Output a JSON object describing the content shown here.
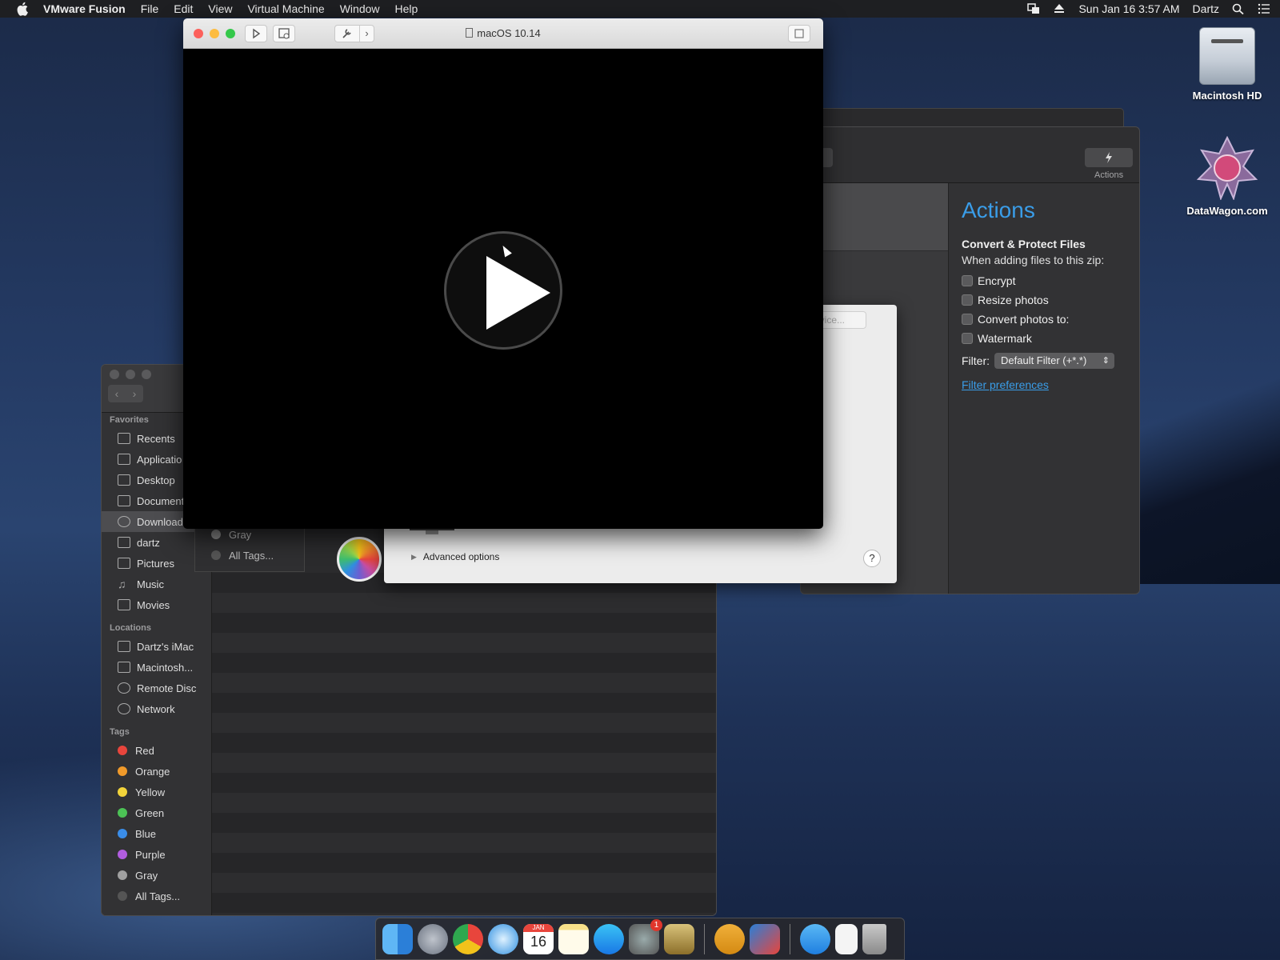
{
  "menubar": {
    "app_name": "VMware Fusion",
    "menus": [
      "File",
      "Edit",
      "View",
      "Virtual Machine",
      "Window",
      "Help"
    ],
    "datetime": "Sun Jan 16  3:57 AM",
    "user": "Dartz"
  },
  "desktop": {
    "icons": [
      {
        "label": "Macintosh HD"
      },
      {
        "label": "DataWagon.com"
      }
    ]
  },
  "vm_window": {
    "title": "macOS 10.14"
  },
  "actions_panel": {
    "toolbar_label": "Actions",
    "title": "Actions",
    "heading": "Convert & Protect Files",
    "subtitle": "When adding files to this zip:",
    "checkboxes": [
      {
        "label": "Encrypt",
        "checked": false
      },
      {
        "label": "Resize photos",
        "checked": false
      },
      {
        "label": "Convert photos to:",
        "checked": false
      },
      {
        "label": "Watermark",
        "checked": false
      }
    ],
    "filter_label": "Filter:",
    "filter_value": "Default Filter (+*.*)",
    "filter_link": "Filter preferences"
  },
  "sheet": {
    "device_field": "evice...",
    "advanced_options": "Advanced options",
    "help": "?"
  },
  "tag_fragment": {
    "items": [
      "Gray",
      "All Tags..."
    ]
  },
  "finder": {
    "sections": {
      "favorites": "Favorites",
      "locations": "Locations",
      "tags": "Tags"
    },
    "favorites": [
      "Recents",
      "Applicatio",
      "Desktop",
      "Document",
      "Download",
      "dartz",
      "Pictures",
      "Music",
      "Movies"
    ],
    "locations": [
      "Dartz's iMac",
      "Macintosh...",
      "Remote Disc",
      "Network"
    ],
    "tags": [
      {
        "label": "Red",
        "color": "#e8453c"
      },
      {
        "label": "Orange",
        "color": "#f09a2a"
      },
      {
        "label": "Yellow",
        "color": "#f2d33a"
      },
      {
        "label": "Green",
        "color": "#4cc255"
      },
      {
        "label": "Blue",
        "color": "#3a8de8"
      },
      {
        "label": "Purple",
        "color": "#b25de0"
      },
      {
        "label": "Gray",
        "color": "#a0a0a0"
      },
      {
        "label": "All Tags...",
        "color": "#555555"
      }
    ]
  },
  "dock": {
    "apps": [
      "finder",
      "launchpad",
      "chrome",
      "safari",
      "calendar",
      "notes",
      "app-store",
      "system-preferences",
      "archive-utility",
      "airmail",
      "vmware-fusion",
      "downloads-folder",
      "document",
      "trash"
    ],
    "calendar_day": "16",
    "calendar_month": "JAN",
    "prefs_badge": "1"
  },
  "colors": {
    "accent": "#3a9de8"
  }
}
